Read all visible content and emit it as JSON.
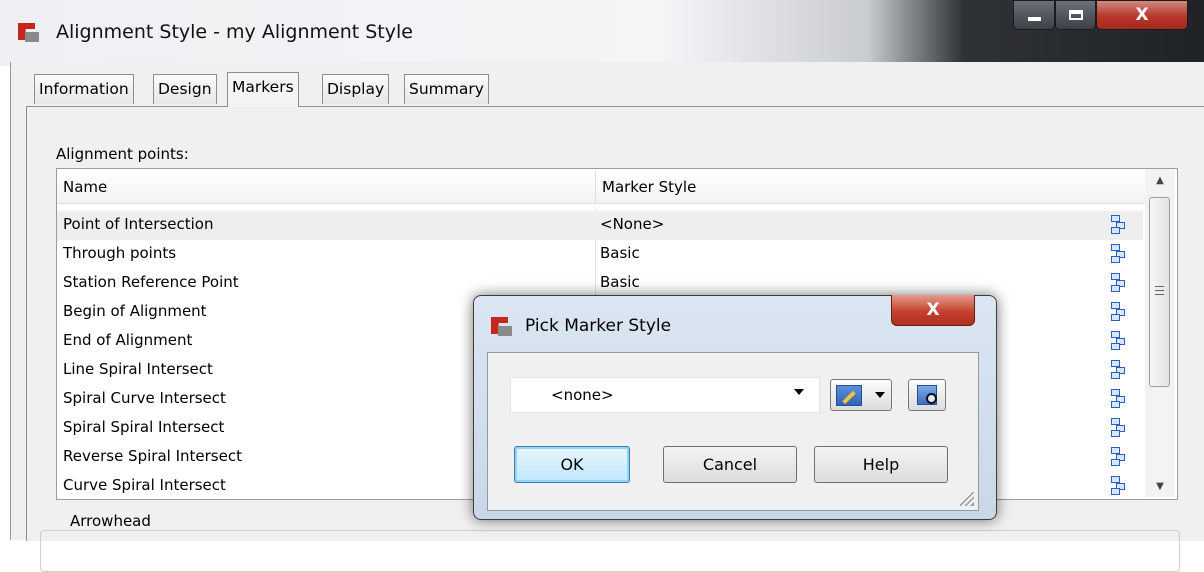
{
  "window": {
    "title": "Alignment Style - my Alignment Style",
    "controls": {
      "minimize": "minimize",
      "maximize": "maximize",
      "close": "X"
    }
  },
  "tabs": [
    {
      "label": "Information",
      "active": false
    },
    {
      "label": "Design",
      "active": false
    },
    {
      "label": "Markers",
      "active": true
    },
    {
      "label": "Display",
      "active": false
    },
    {
      "label": "Summary",
      "active": false
    }
  ],
  "markers": {
    "section_label": "Alignment points:",
    "columns": {
      "name": "Name",
      "style": "Marker Style"
    },
    "rows": [
      {
        "name": "Point of Intersection",
        "style": "<None>",
        "selected": true
      },
      {
        "name": "Through points",
        "style": "Basic"
      },
      {
        "name": "Station Reference Point",
        "style": "Basic"
      },
      {
        "name": "Begin of Alignment",
        "style": ""
      },
      {
        "name": "End of Alignment",
        "style": ""
      },
      {
        "name": "Line Spiral Intersect",
        "style": ""
      },
      {
        "name": "Spiral Curve Intersect",
        "style": ""
      },
      {
        "name": "Spiral Spiral Intersect",
        "style": ""
      },
      {
        "name": "Reverse Spiral Intersect",
        "style": ""
      },
      {
        "name": "Curve Spiral Intersect",
        "style": ""
      }
    ],
    "arrowhead_label": "Arrowhead"
  },
  "dialog": {
    "title": "Pick Marker Style",
    "close": "X",
    "combo_value": "<none>",
    "buttons": {
      "ok": "OK",
      "cancel": "Cancel",
      "help": "Help"
    }
  },
  "icons": {
    "app": "civil3d-app-icon",
    "style_picker": "marker-style-picker-icon",
    "edit_style": "edit-style-icon",
    "browse": "browse-style-icon"
  },
  "colors": {
    "selection": "#eeeeee",
    "dialog_frame": "#c9d7e6",
    "close_button": "#c6422f",
    "default_button": "#bee6fd"
  }
}
